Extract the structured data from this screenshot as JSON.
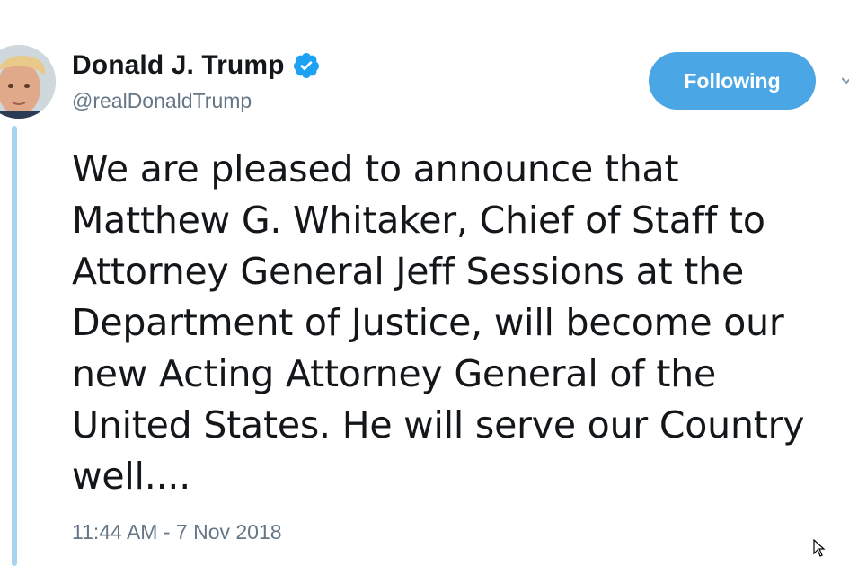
{
  "tweet": {
    "author": {
      "display_name": "Donald J. Trump",
      "handle": "@realDonaldTrump",
      "verified": true,
      "avatar_icon": "profile-photo"
    },
    "follow_button_label": "Following",
    "text": "We are pleased to announce that\nMatthew G. Whitaker, Chief of Staff to\nAttorney General Jeff Sessions at the\nDepartment of Justice, will become our\nnew Acting Attorney General of the\nUnited States. He will serve our Country\nwell....",
    "timestamp": "11:44 AM - 7 Nov 2018"
  },
  "colors": {
    "accent": "#4aa6e4",
    "verified": "#1da1f2",
    "secondary_text": "#657786",
    "thread_line": "#a7d3ee"
  }
}
